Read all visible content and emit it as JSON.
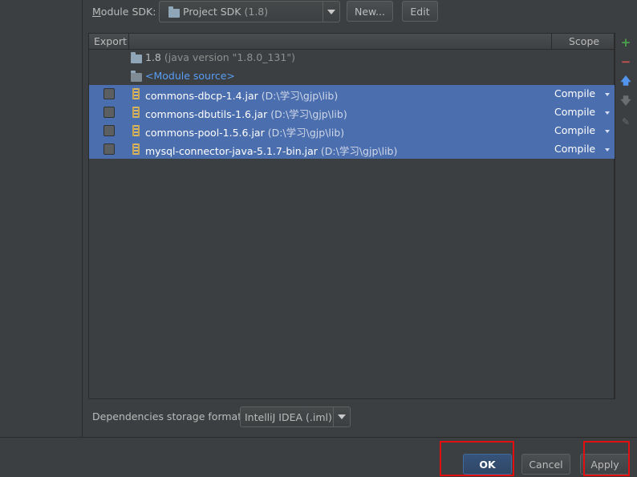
{
  "module_sdk": {
    "label_prefix": "M",
    "label_rest": "odule SDK:",
    "selected": "Project SDK",
    "selected_detail": "(1.8)",
    "new_button": "New...",
    "edit_button": "Edit"
  },
  "table": {
    "headers": {
      "export": "Export",
      "scope": "Scope"
    },
    "sdk_row": {
      "name": "1.8",
      "detail": "(java version \"1.8.0_131\")"
    },
    "module_source": "<Module source>",
    "rows": [
      {
        "name": "commons-dbcp-1.4.jar",
        "path": "(D:\\学习\\gjp\\lib)",
        "scope": "Compile",
        "export": false
      },
      {
        "name": "commons-dbutils-1.6.jar",
        "path": "(D:\\学习\\gjp\\lib)",
        "scope": "Compile",
        "export": false
      },
      {
        "name": "commons-pool-1.5.6.jar",
        "path": "(D:\\学习\\gjp\\lib)",
        "scope": "Compile",
        "export": false
      },
      {
        "name": "mysql-connector-java-5.1.7-bin.jar",
        "path": "(D:\\学习\\gjp\\lib)",
        "scope": "Compile",
        "export": false
      }
    ]
  },
  "toolbar_icons": [
    "add-icon",
    "remove-icon",
    "move-up-icon",
    "move-down-icon",
    "edit-icon"
  ],
  "storage": {
    "label": "Dependencies storage format:",
    "value": "IntelliJ IDEA (.iml)"
  },
  "footer": {
    "ok": "OK",
    "cancel": "Cancel",
    "apply": "Apply"
  },
  "colors": {
    "background": "#3c3f41",
    "selection": "#4b6eaf",
    "highlight_box": "#e01010",
    "add": "#4aa34a",
    "remove": "#c75450",
    "arrow_up": "#5394ec"
  }
}
